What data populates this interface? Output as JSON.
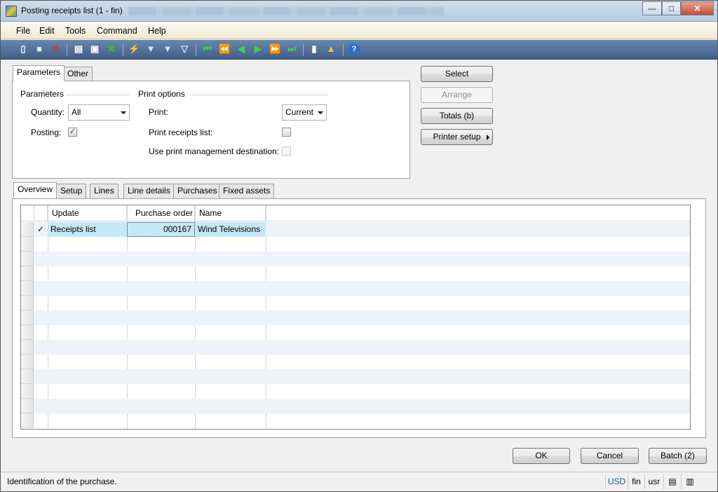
{
  "window": {
    "title": "Posting receipts list (1 - fin)",
    "controls": {
      "minimize": "—",
      "maximize": "□",
      "close": "✕"
    }
  },
  "menu": [
    "File",
    "Edit",
    "Tools",
    "Command",
    "Help"
  ],
  "toolbar": {
    "icons": [
      "new-icon",
      "save-icon",
      "delete-icon",
      "print-icon",
      "print-preview-icon",
      "export-excel-icon",
      "filter-by-selection-icon",
      "filter-by-grid-icon",
      "advanced-filter-icon",
      "remove-filter-icon",
      "first-record-icon",
      "previous-page-icon",
      "previous-record-icon",
      "next-record-icon",
      "next-page-icon",
      "last-record-icon",
      "document-handling-icon",
      "alert-icon",
      "help-icon"
    ]
  },
  "top_tabs": [
    "Parameters",
    "Other"
  ],
  "parameters": {
    "group_title": "Parameters",
    "quantity_label": "Quantity:",
    "quantity_value": "All",
    "posting_label": "Posting:",
    "posting_checked": true
  },
  "print_options": {
    "group_title": "Print options",
    "print_label": "Print:",
    "print_value": "Current",
    "print_receipts_label": "Print receipts list:",
    "print_receipts_checked": false,
    "use_print_mgmt_label": "Use print management destination:",
    "use_print_mgmt_checked": false
  },
  "side_buttons": {
    "select": "Select",
    "arrange": "Arrange",
    "totals": "Totals (b)",
    "printer_setup": "Printer setup"
  },
  "bottom_tabs": [
    "Overview",
    "Setup",
    "Lines",
    "Line details",
    "Purchases",
    "Fixed assets"
  ],
  "grid": {
    "columns": [
      "Update",
      "Purchase order",
      "Name"
    ],
    "rows": [
      {
        "check": "✓",
        "update": "Receipts list",
        "purchase_order": "000167",
        "name": "Wind Televisions"
      }
    ]
  },
  "dialog_buttons": {
    "ok": "OK",
    "cancel": "Cancel",
    "batch": "Batch (2)"
  },
  "status": {
    "text": "Identification of the purchase.",
    "currency": "USD",
    "company": "fin",
    "layer": "usr"
  },
  "colors": {
    "toolbar": "#4f6f9a",
    "selection": "#c6e8f4",
    "row_alt": "#eef3fa"
  }
}
